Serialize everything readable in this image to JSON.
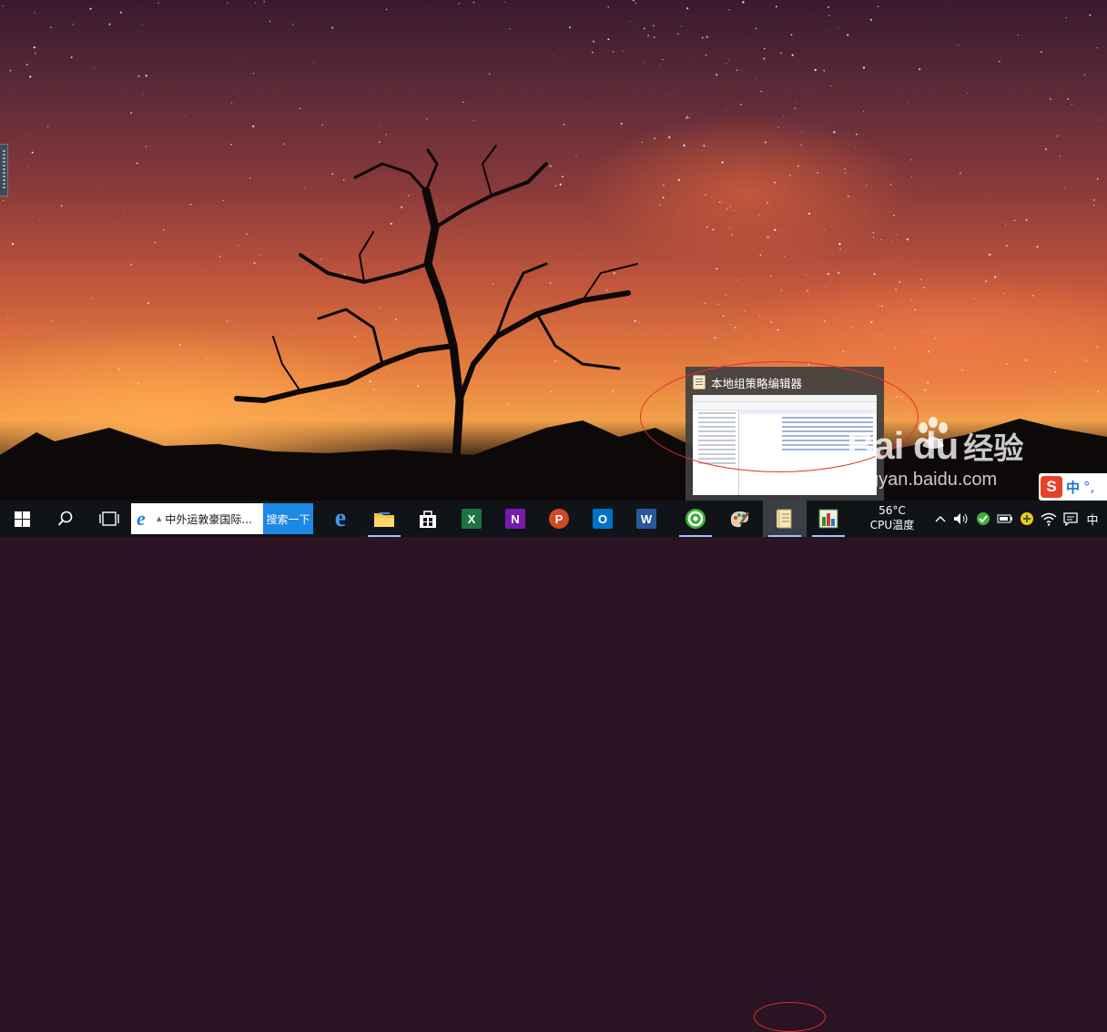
{
  "preview": {
    "title": "本地组策略编辑器",
    "icon": "policy-document-icon"
  },
  "watermark": {
    "logo": "Bai du",
    "logo_cn": "经验",
    "url": "jingyan.baidu.com"
  },
  "ime_bar": {
    "logo": "S",
    "mode": "中",
    "punct": "°,"
  },
  "taskbar": {
    "search_text": "中外运敦豪国际...",
    "search_button": "搜索一下",
    "apps": [
      {
        "name": "edge",
        "icon": "edge-icon"
      },
      {
        "name": "file-explorer",
        "icon": "folder-icon"
      },
      {
        "name": "store",
        "icon": "store-icon"
      },
      {
        "name": "excel",
        "icon": "excel-icon",
        "letter": "X"
      },
      {
        "name": "onenote",
        "icon": "onenote-icon",
        "letter": "N"
      },
      {
        "name": "powerpoint",
        "icon": "powerpoint-icon",
        "letter": "P"
      },
      {
        "name": "outlook",
        "icon": "outlook-icon",
        "letter": "O"
      },
      {
        "name": "word",
        "icon": "word-icon",
        "letter": "W"
      },
      {
        "name": "360-browser",
        "icon": "green-circle-icon"
      },
      {
        "name": "paint",
        "icon": "palette-icon"
      },
      {
        "name": "group-policy-editor",
        "icon": "policy-document-icon"
      },
      {
        "name": "task-manager",
        "icon": "chart-icon"
      }
    ],
    "cpu_temp": "56°C",
    "cpu_label": "CPU温度",
    "ime_indicator": "中"
  },
  "colors": {
    "taskbar_bg": "#101418",
    "search_button": "#1e88e5",
    "annotation": "#e53028",
    "excel": "#1e7145",
    "onenote": "#7719aa",
    "powerpoint": "#d24726",
    "outlook": "#0072c6",
    "word": "#2b579a"
  }
}
